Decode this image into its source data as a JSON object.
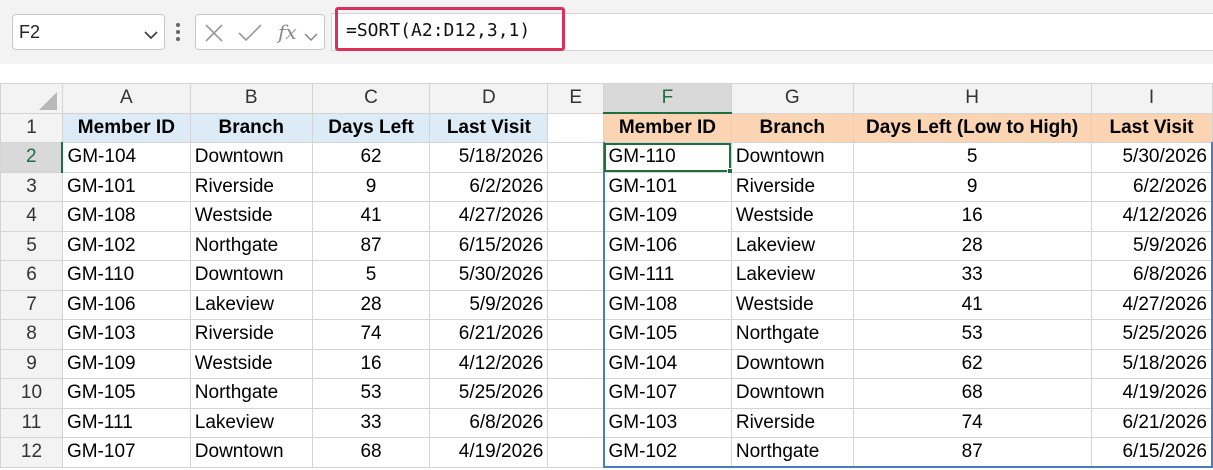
{
  "namebox": {
    "value": "F2"
  },
  "formula": {
    "text": "=SORT(A2:D12,3,1)",
    "fx_label": "fx"
  },
  "columns": [
    "A",
    "B",
    "C",
    "D",
    "E",
    "F",
    "G",
    "H",
    "I"
  ],
  "rows": [
    "1",
    "2",
    "3",
    "4",
    "5",
    "6",
    "7",
    "8",
    "9",
    "10",
    "11",
    "12"
  ],
  "source_table": {
    "headers": [
      "Member ID",
      "Branch",
      "Days Left",
      "Last Visit"
    ],
    "rows": [
      [
        "GM-104",
        "Downtown",
        "62",
        "5/18/2026"
      ],
      [
        "GM-101",
        "Riverside",
        "9",
        "6/2/2026"
      ],
      [
        "GM-108",
        "Westside",
        "41",
        "4/27/2026"
      ],
      [
        "GM-102",
        "Northgate",
        "87",
        "6/15/2026"
      ],
      [
        "GM-110",
        "Downtown",
        "5",
        "5/30/2026"
      ],
      [
        "GM-106",
        "Lakeview",
        "28",
        "5/9/2026"
      ],
      [
        "GM-103",
        "Riverside",
        "74",
        "6/21/2026"
      ],
      [
        "GM-109",
        "Westside",
        "16",
        "4/12/2026"
      ],
      [
        "GM-105",
        "Northgate",
        "53",
        "5/25/2026"
      ],
      [
        "GM-111",
        "Lakeview",
        "33",
        "6/8/2026"
      ],
      [
        "GM-107",
        "Downtown",
        "68",
        "4/19/2026"
      ]
    ]
  },
  "sorted_table": {
    "headers": [
      "Member ID",
      "Branch",
      "Days Left (Low to High)",
      "Last Visit"
    ],
    "rows": [
      [
        "GM-110",
        "Downtown",
        "5",
        "5/30/2026"
      ],
      [
        "GM-101",
        "Riverside",
        "9",
        "6/2/2026"
      ],
      [
        "GM-109",
        "Westside",
        "16",
        "4/12/2026"
      ],
      [
        "GM-106",
        "Lakeview",
        "28",
        "5/9/2026"
      ],
      [
        "GM-111",
        "Lakeview",
        "33",
        "6/8/2026"
      ],
      [
        "GM-108",
        "Westside",
        "41",
        "4/27/2026"
      ],
      [
        "GM-105",
        "Northgate",
        "53",
        "5/25/2026"
      ],
      [
        "GM-104",
        "Downtown",
        "62",
        "5/18/2026"
      ],
      [
        "GM-107",
        "Downtown",
        "68",
        "4/19/2026"
      ],
      [
        "GM-103",
        "Riverside",
        "74",
        "6/21/2026"
      ],
      [
        "GM-102",
        "Northgate",
        "87",
        "6/15/2026"
      ]
    ]
  },
  "colors": {
    "header_blue": "#ddebf7",
    "header_orange": "#fbd4b4",
    "formula_highlight": "#d9305c",
    "selection_green": "#1e6e3f",
    "spill_border": "#4a7ebb"
  },
  "icons": [
    "chevron-down-icon",
    "more-dots-icon",
    "cancel-x-icon",
    "enter-check-icon",
    "fx-icon",
    "fx-chevron-icon",
    "select-all-triangle-icon"
  ]
}
